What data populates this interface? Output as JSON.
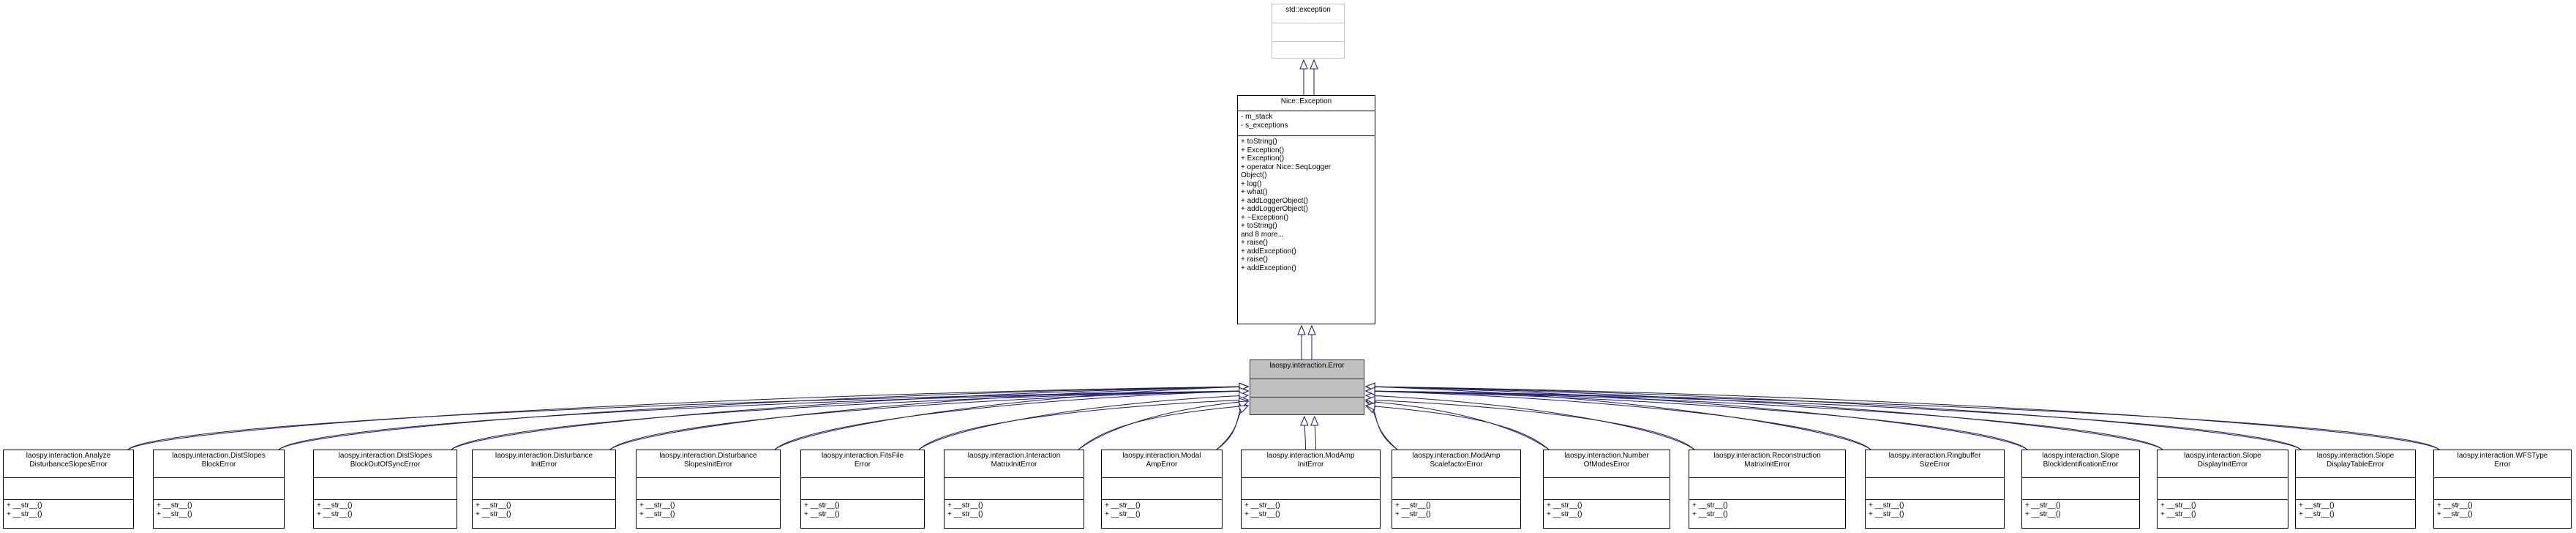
{
  "colors": {
    "edge": "#191970",
    "highlight_fill": "#bfbfbf",
    "border": "#000000"
  },
  "root": {
    "name": [
      "std::exception"
    ],
    "attributes": [],
    "methods": []
  },
  "parent": {
    "name": [
      "Nice::Exception"
    ],
    "attributes": [
      "- m_stack",
      "- s_exceptions"
    ],
    "methods": [
      "+ toString()",
      "+ Exception()",
      "+ Exception()",
      "+ operator Nice::SeqLogger",
      "Object()",
      "+ log()",
      "+ what()",
      "+ addLoggerObject()",
      "+ addLoggerObject()",
      "+ ~Exception()",
      "+ toString()",
      "and 8 more...",
      "+ raise()",
      "+ addException()",
      "+ raise()",
      "+ addException()"
    ]
  },
  "focus": {
    "name": [
      "laospy.interaction.Error"
    ],
    "attributes": [],
    "methods": []
  },
  "children": [
    {
      "name": [
        "laospy.interaction.Analyze",
        "DisturbanceSlopesError"
      ],
      "methods": [
        "+ __str__()",
        "+ __str__()"
      ]
    },
    {
      "name": [
        "laospy.interaction.DistSlopes",
        "BlockError"
      ],
      "methods": [
        "+ __str__()",
        "+ __str__()"
      ]
    },
    {
      "name": [
        "laospy.interaction.DistSlopes",
        "BlockOutOfSyncError"
      ],
      "methods": [
        "+ __str__()",
        "+ __str__()"
      ]
    },
    {
      "name": [
        "laospy.interaction.Disturbance",
        "InitError"
      ],
      "methods": [
        "+ __str__()",
        "+ __str__()"
      ]
    },
    {
      "name": [
        "laospy.interaction.Disturbance",
        "SlopesInitError"
      ],
      "methods": [
        "+ __str__()",
        "+ __str__()"
      ]
    },
    {
      "name": [
        "laospy.interaction.FitsFile",
        "Error"
      ],
      "methods": [
        "+ __str__()",
        "+ __str__()"
      ]
    },
    {
      "name": [
        "laospy.interaction.Interaction",
        "MatrixInitError"
      ],
      "methods": [
        "+ __str__()",
        "+ __str__()"
      ]
    },
    {
      "name": [
        "laospy.interaction.Modal",
        "AmpError"
      ],
      "methods": [
        "+ __str__()",
        "+ __str__()"
      ]
    },
    {
      "name": [
        "laospy.interaction.ModAmp",
        "InitError"
      ],
      "methods": [
        "+ __str__()",
        "+ __str__()"
      ]
    },
    {
      "name": [
        "laospy.interaction.ModAmp",
        "ScalefactorError"
      ],
      "methods": [
        "+ __str__()",
        "+ __str__()"
      ]
    },
    {
      "name": [
        "laospy.interaction.Number",
        "OfModesError"
      ],
      "methods": [
        "+ __str__()",
        "+ __str__()"
      ]
    },
    {
      "name": [
        "laospy.interaction.Reconstruction",
        "MatrixInitError"
      ],
      "methods": [
        "+ __str__()",
        "+ __str__()"
      ]
    },
    {
      "name": [
        "laospy.interaction.Ringbuffer",
        "SizeError"
      ],
      "methods": [
        "+ __str__()",
        "+ __str__()"
      ]
    },
    {
      "name": [
        "laospy.interaction.Slope",
        "BlockIdentificationError"
      ],
      "methods": [
        "+ __str__()",
        "+ __str__()"
      ]
    },
    {
      "name": [
        "laospy.interaction.Slope",
        "DisplayInitError"
      ],
      "methods": [
        "+ __str__()",
        "+ __str__()"
      ]
    },
    {
      "name": [
        "laospy.interaction.Slope",
        "DisplayTableError"
      ],
      "methods": [
        "+ __str__()",
        "+ __str__()"
      ]
    },
    {
      "name": [
        "laospy.interaction.WFSType",
        "Error"
      ],
      "methods": [
        "+ __str__()",
        "+ __str__()"
      ]
    }
  ]
}
